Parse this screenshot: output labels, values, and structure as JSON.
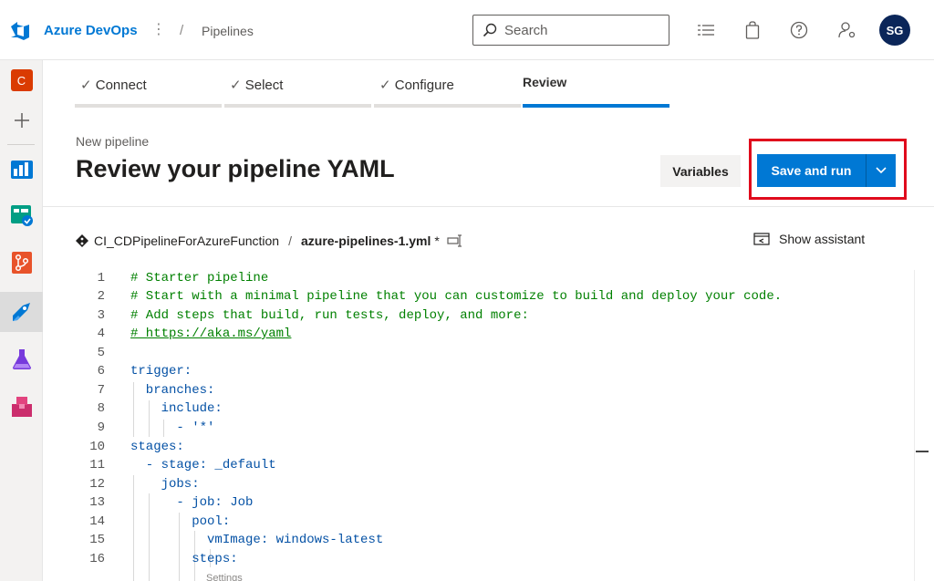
{
  "header": {
    "brand": "Azure DevOps",
    "kebab": "⋮",
    "slash": "/",
    "breadcrumb": "Pipelines",
    "search_placeholder": "Search",
    "avatar_initials": "SG"
  },
  "rail": {
    "project_initial": "C",
    "items": [
      "overview",
      "boards",
      "test-plans",
      "repos",
      "pipelines",
      "test-plans-flask",
      "artifacts"
    ]
  },
  "steps": [
    {
      "label": "Connect",
      "done": true
    },
    {
      "label": "Select",
      "done": true
    },
    {
      "label": "Configure",
      "done": true
    },
    {
      "label": "Review",
      "active": true
    }
  ],
  "page": {
    "subtitle": "New pipeline",
    "title": "Review your pipeline YAML",
    "variables_label": "Variables",
    "save_run_label": "Save and run"
  },
  "file": {
    "repo": "CI_CDPipelineForAzureFunction",
    "separator": "/",
    "name": "azure-pipelines-1.yml",
    "modified_marker": "*",
    "assistant_label": "Show assistant"
  },
  "editor": {
    "lines": [
      {
        "n": "1",
        "text": "# Starter pipeline"
      },
      {
        "n": "2",
        "text": "# Start with a minimal pipeline that you can customize to build and deploy your code."
      },
      {
        "n": "3",
        "text": "# Add steps that build, run tests, deploy, and more:"
      },
      {
        "n": "4",
        "text": "# https://aka.ms/yaml"
      },
      {
        "n": "5",
        "text": ""
      },
      {
        "n": "6",
        "text": "trigger:"
      },
      {
        "n": "7",
        "text": "  branches:"
      },
      {
        "n": "8",
        "text": "    include:"
      },
      {
        "n": "9",
        "text": "      - '*'"
      },
      {
        "n": "10",
        "text": "stages:"
      },
      {
        "n": "11",
        "text": "  - stage: _default"
      },
      {
        "n": "12",
        "text": "    jobs:"
      },
      {
        "n": "13",
        "text": "      - job: Job"
      },
      {
        "n": "14",
        "text": "        pool:"
      },
      {
        "n": "15",
        "text": "          vmImage: windows-latest"
      },
      {
        "n": "16",
        "text": "        steps:"
      }
    ],
    "hint": "Settings"
  },
  "colors": {
    "accent": "#0078d4",
    "highlight": "#e00b1c",
    "comment": "#008000",
    "key": "#0451a5"
  }
}
